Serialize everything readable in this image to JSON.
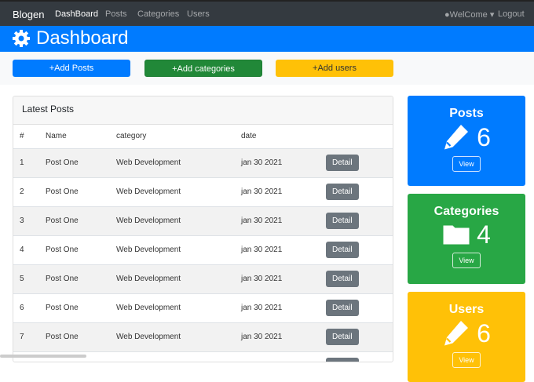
{
  "navbar": {
    "brand": "Blogen",
    "links": [
      "DashBoard",
      "Posts",
      "Categories",
      "Users"
    ],
    "user": "WelCome",
    "logout": "Logout"
  },
  "header": {
    "title": "Dashboard"
  },
  "actions": {
    "add_posts": "+Add Posts",
    "add_categories": "+Add categories",
    "add_users": "+Add users"
  },
  "latest_posts": {
    "title": "Latest Posts",
    "columns": [
      "#",
      "Name",
      "category",
      "date"
    ],
    "detail_label": "Detail",
    "rows": [
      {
        "n": "1",
        "name": "Post One",
        "category": "Web Development",
        "date": "jan 30 2021"
      },
      {
        "n": "2",
        "name": "Post One",
        "category": "Web Development",
        "date": "jan 30 2021"
      },
      {
        "n": "3",
        "name": "Post One",
        "category": "Web Development",
        "date": "jan 30 2021"
      },
      {
        "n": "4",
        "name": "Post One",
        "category": "Web Development",
        "date": "jan 30 2021"
      },
      {
        "n": "5",
        "name": "Post One",
        "category": "Web Development",
        "date": "jan 30 2021"
      },
      {
        "n": "6",
        "name": "Post One",
        "category": "Web Development",
        "date": "jan 30 2021"
      },
      {
        "n": "7",
        "name": "Post One",
        "category": "Web Development",
        "date": "jan 30 2021"
      },
      {
        "n": "",
        "name": "",
        "category": "",
        "date": ""
      }
    ]
  },
  "stats": [
    {
      "title": "Posts",
      "count": "6",
      "view": "View",
      "color": "#007bff",
      "icon": "pencil-icon"
    },
    {
      "title": "Categories",
      "count": "4",
      "view": "View",
      "color": "#28a745",
      "icon": "folder-icon"
    },
    {
      "title": "Users",
      "count": "6",
      "view": "View",
      "color": "#ffc107",
      "icon": "pencil-icon"
    }
  ]
}
